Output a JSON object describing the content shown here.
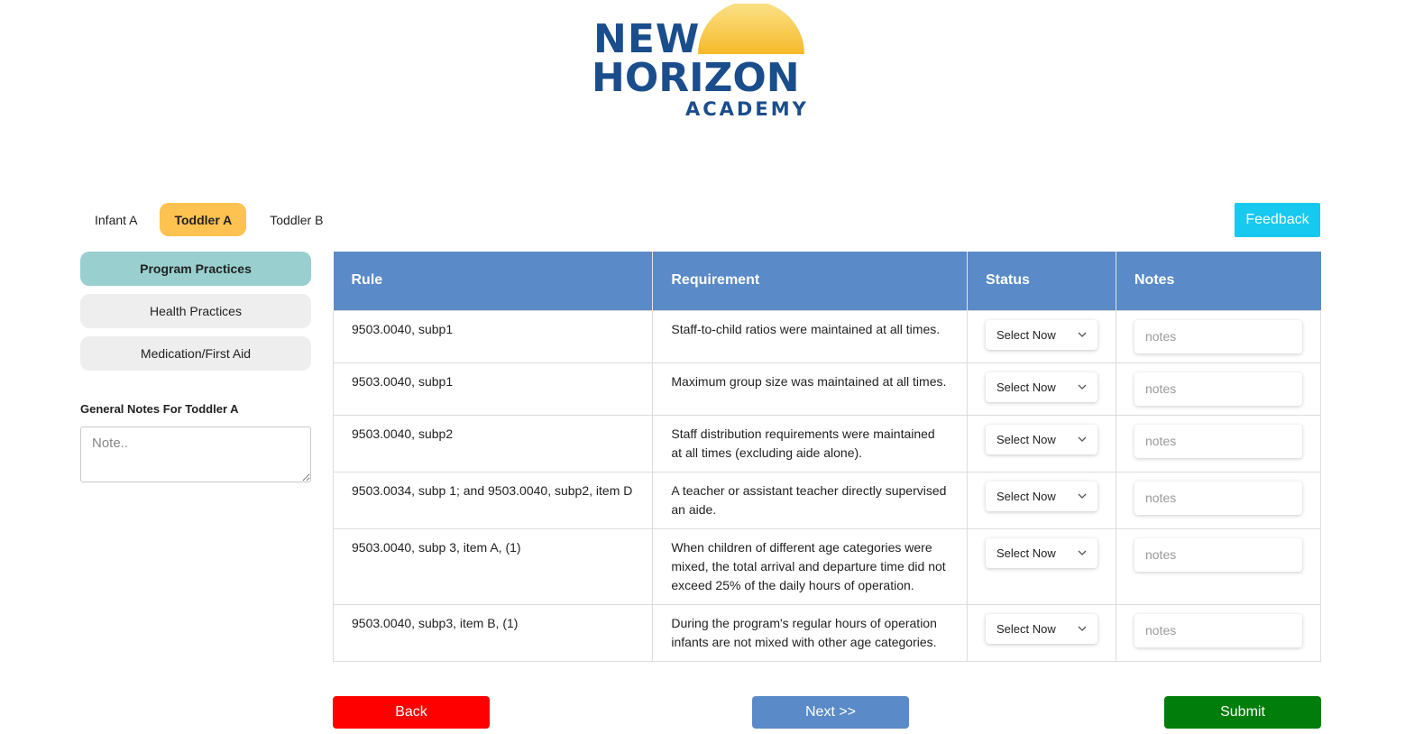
{
  "brand": {
    "line1": "NEW",
    "line2": "HORIZON",
    "line3": "ACADEMY",
    "text_color": "#1a4d8c",
    "sun_color": "#f9c93c"
  },
  "class_tabs": [
    "Infant A",
    "Toddler A",
    "Toddler B"
  ],
  "active_class": "Toddler A",
  "feedback_label": "Feedback",
  "sidebar": {
    "items": [
      {
        "label": "Program Practices",
        "active": true
      },
      {
        "label": "Health Practices",
        "active": false
      },
      {
        "label": "Medication/First Aid",
        "active": false
      }
    ],
    "general_notes_label": "General Notes For Toddler A",
    "general_notes_placeholder": "Note.."
  },
  "table": {
    "headers": [
      "Rule",
      "Requirement",
      "Status",
      "Notes"
    ],
    "rows": [
      {
        "rule": "9503.0040, subp1",
        "requirement": "Staff-to-child ratios were maintained at all times.",
        "status": "Select Now",
        "notes_placeholder": "notes"
      },
      {
        "rule": "9503.0040, subp1",
        "requirement": "Maximum group size was maintained at all times.",
        "status": "Select Now",
        "notes_placeholder": "notes"
      },
      {
        "rule": "9503.0040, subp2",
        "requirement": "Staff distribution requirements were maintained at all times (excluding aide alone).",
        "status": "Select Now",
        "notes_placeholder": "notes"
      },
      {
        "rule": "9503.0034, subp 1; and 9503.0040, subp2, item D",
        "requirement": "A teacher or assistant teacher directly supervised an aide.",
        "status": "Select Now",
        "notes_placeholder": "notes"
      },
      {
        "rule": "9503.0040, subp 3, item A, (1)",
        "requirement": "When children of different age categories were mixed, the total arrival and departure time did not exceed 25% of the daily hours of operation.",
        "status": "Select Now",
        "notes_placeholder": "notes"
      },
      {
        "rule": "9503.0040, subp3, item B, (1)",
        "requirement": "During the program's regular hours of operation infants are not mixed with other age categories.",
        "status": "Select Now",
        "notes_placeholder": "notes"
      }
    ]
  },
  "buttons": {
    "back": "Back",
    "next": "Next >>",
    "submit": "Submit"
  },
  "colors": {
    "table_header": "#5a8ac8",
    "active_tab": "#fdc24f",
    "active_sidebar": "#99cfcf",
    "feedback": "#17c9ef",
    "back": "#ff0000",
    "next": "#5a8ac8",
    "submit": "#007d0a"
  }
}
